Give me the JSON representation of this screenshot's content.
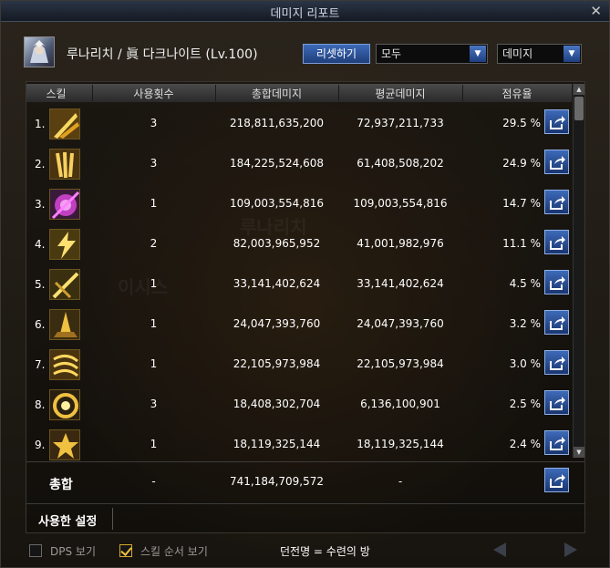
{
  "window": {
    "title": "데미지 리포트",
    "close_glyph": "✕"
  },
  "character": {
    "name": "루나리치 / 眞 다크나이트 (Lv.100)"
  },
  "controls": {
    "reset_label": "리셋하기",
    "filter_value": "모두",
    "metric_value": "데미지"
  },
  "table": {
    "headers": [
      "스킬",
      "사용횟수",
      "총합데미지",
      "평균데미지",
      "점유율"
    ],
    "rows": [
      {
        "rank": "1.",
        "icon": "golden-slash-skill-icon",
        "count": "3",
        "total": "218,811,635,200",
        "average": "72,937,211,733",
        "share": "29.5 %"
      },
      {
        "rank": "2.",
        "icon": "golden-claw-skill-icon",
        "count": "3",
        "total": "184,225,524,608",
        "average": "61,408,508,202",
        "share": "24.9 %"
      },
      {
        "rank": "3.",
        "icon": "purple-saw-skill-icon",
        "count": "1",
        "total": "109,003,554,816",
        "average": "109,003,554,816",
        "share": "14.7 %"
      },
      {
        "rank": "4.",
        "icon": "golden-lightning-skill-icon",
        "count": "2",
        "total": "82,003,965,952",
        "average": "41,001,982,976",
        "share": "11.1 %"
      },
      {
        "rank": "5.",
        "icon": "golden-cross-slash-skill-icon",
        "count": "1",
        "total": "33,141,402,624",
        "average": "33,141,402,624",
        "share": "4.5 %"
      },
      {
        "rank": "6.",
        "icon": "golden-spike-skill-icon",
        "count": "1",
        "total": "24,047,393,760",
        "average": "24,047,393,760",
        "share": "3.2 %"
      },
      {
        "rank": "7.",
        "icon": "golden-wind-skill-icon",
        "count": "1",
        "total": "22,105,973,984",
        "average": "22,105,973,984",
        "share": "3.0 %"
      },
      {
        "rank": "8.",
        "icon": "golden-vortex-skill-icon",
        "count": "3",
        "total": "18,408,302,704",
        "average": "6,136,100,901",
        "share": "2.5 %"
      },
      {
        "rank": "9.",
        "icon": "golden-burst-skill-icon",
        "count": "1",
        "total": "18,119,325,144",
        "average": "18,119,325,144",
        "share": "2.4 %"
      }
    ],
    "total": {
      "label": "총합",
      "count": "-",
      "total": "741,184,709,572",
      "average": "-"
    },
    "settings_label": "사용한 설정"
  },
  "footer": {
    "dps_label": "DPS 보기",
    "dps_checked": false,
    "order_label": "스킬 순서 보기",
    "order_checked": true,
    "dungeon": "던전명 = 수련의 방"
  },
  "colors": {
    "accent_blue": "#3d6ab8",
    "gold": "#f0c040",
    "panel": "#17140f"
  }
}
